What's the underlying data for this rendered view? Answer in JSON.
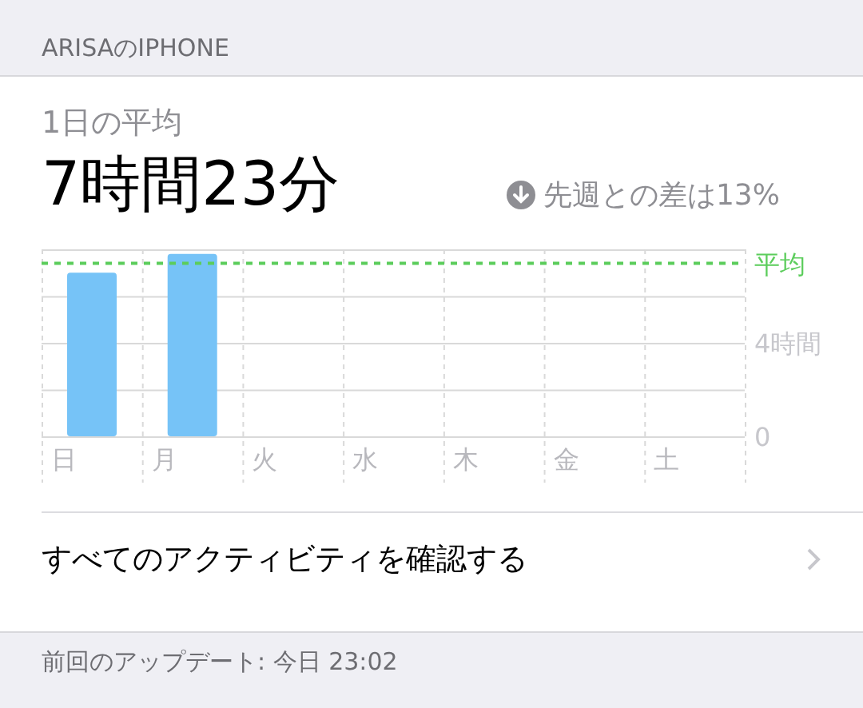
{
  "section_header": "ARISAのIPHONE",
  "summary": {
    "label": "1日の平均",
    "value": "7時間23分",
    "change": "先週との差は13%",
    "decreased": true
  },
  "chart_data": {
    "type": "bar",
    "categories": [
      "日",
      "月",
      "火",
      "水",
      "木",
      "金",
      "土"
    ],
    "series": [
      {
        "color": "#76c3f7",
        "values": [
          7.0,
          7.8,
          null,
          null,
          null,
          null,
          null
        ]
      }
    ],
    "ylim": [
      0,
      8
    ],
    "yticks": [
      0,
      {
        "value": 4,
        "label": "4時間"
      }
    ],
    "ref_lines": [
      {
        "label": "平均",
        "color": "#5ccd5c"
      }
    ]
  },
  "link_row": {
    "label": "すべてのアクティビティを確認する"
  },
  "footer": "前回のアップデート: 今日 23:02"
}
